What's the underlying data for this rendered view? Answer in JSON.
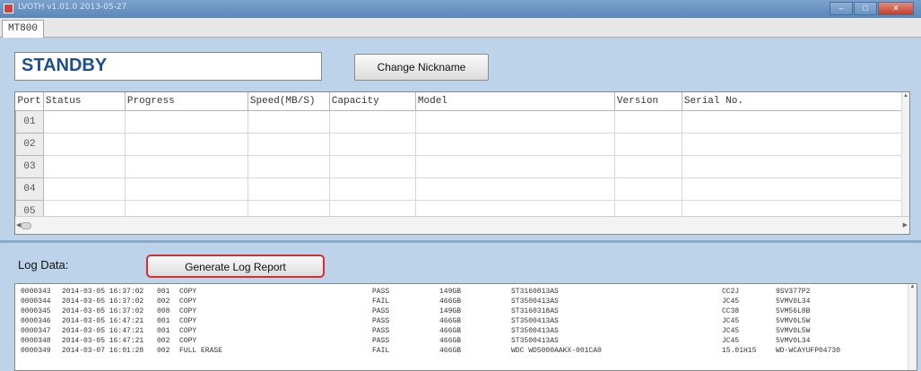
{
  "window": {
    "title": "LVOTH v1.01.0 2013-05-27"
  },
  "tabs": [
    {
      "label": "MT800"
    }
  ],
  "status": {
    "text": "STANDBY"
  },
  "buttons": {
    "change_nickname": "Change Nickname",
    "generate_log": "Generate Log Report"
  },
  "ports_table": {
    "headers": [
      "Port",
      "Status",
      "Progress",
      "Speed(MB/S)",
      "Capacity",
      "Model",
      "Version",
      "Serial No."
    ],
    "rows": [
      "01",
      "02",
      "03",
      "04",
      "05"
    ]
  },
  "log": {
    "label": "Log Data:",
    "entries": [
      {
        "id": "0000343",
        "datetime": "2014-03-05 16:37:02",
        "port": "001",
        "op": "COPY",
        "result": "PASS",
        "capacity": "149GB",
        "model": "ST3160813AS",
        "version": "CC2J",
        "serial": "9SV377P2"
      },
      {
        "id": "0000344",
        "datetime": "2014-03-05 16:37:02",
        "port": "002",
        "op": "COPY",
        "result": "FAIL",
        "capacity": "466GB",
        "model": "ST3500413AS",
        "version": "JC45",
        "serial": "5VMV0L34"
      },
      {
        "id": "0000345",
        "datetime": "2014-03-05 16:37:02",
        "port": "008",
        "op": "COPY",
        "result": "PASS",
        "capacity": "149GB",
        "model": "ST3160318AS",
        "version": "CC38",
        "serial": "5VM56L8B"
      },
      {
        "id": "0000346",
        "datetime": "2014-03-05 16:47:21",
        "port": "001",
        "op": "COPY",
        "result": "PASS",
        "capacity": "466GB",
        "model": "ST3500413AS",
        "version": "JC45",
        "serial": "5VMV0L5W"
      },
      {
        "id": "0000347",
        "datetime": "2014-03-05 16:47:21",
        "port": "001",
        "op": "COPY",
        "result": "PASS",
        "capacity": "466GB",
        "model": "ST3500413AS",
        "version": "JC45",
        "serial": "5VMV0L5W"
      },
      {
        "id": "0000348",
        "datetime": "2014-03-05 16:47:21",
        "port": "002",
        "op": "COPY",
        "result": "PASS",
        "capacity": "466GB",
        "model": "ST3500413AS",
        "version": "JC45",
        "serial": "5VMV0L34"
      },
      {
        "id": "0000349",
        "datetime": "2014-03-07 16:01:28",
        "port": "002",
        "op": "FULL ERASE",
        "result": "FAIL",
        "capacity": "466GB",
        "model": "WDC WD5000AAKX-001CA0",
        "version": "15.01H15",
        "serial": "WD-WCAYUFP04730"
      }
    ]
  },
  "colors": {
    "background": "#bcd3ea",
    "status_text": "#1c4e91",
    "highlight_border": "#d62e2e"
  }
}
